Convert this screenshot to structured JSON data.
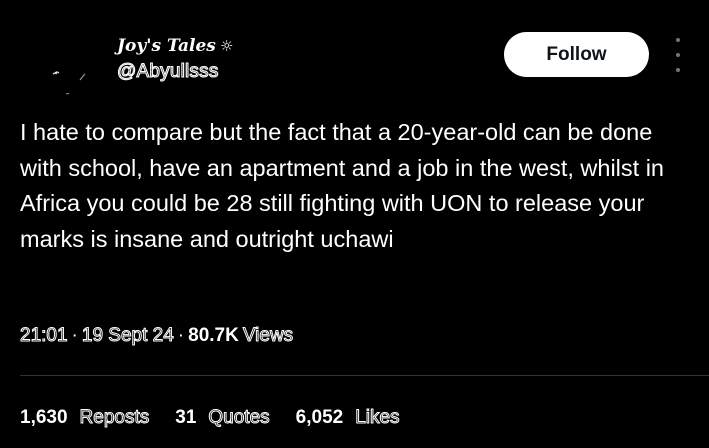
{
  "author": {
    "display_name": "Joy's Tales",
    "name_glyph": "☼",
    "handle": "@Abyullsss",
    "avatar_icon": "profile-avatar"
  },
  "actions": {
    "follow_label": "Follow",
    "more_icon": "more-vertical-icon"
  },
  "tweet": {
    "text": "I hate to compare but the fact that a 20-year-old can be done with school, have an apartment and a job in the west, whilst in Africa you could be 28 still fighting with UON to release your marks is insane and outright uchawi"
  },
  "meta": {
    "time": "21:01",
    "separator": "·",
    "date": "19 Sept 24",
    "views_count": "80.7K",
    "views_label": "Views"
  },
  "stats": [
    {
      "count": "1,630",
      "label": "Reposts"
    },
    {
      "count": "31",
      "label": "Quotes"
    },
    {
      "count": "6,052",
      "label": "Likes"
    }
  ],
  "colors": {
    "background": "#000000",
    "text": "#ffffff",
    "button_bg": "#ffffff",
    "button_text": "#0f1419",
    "divider": "#2f3336"
  }
}
